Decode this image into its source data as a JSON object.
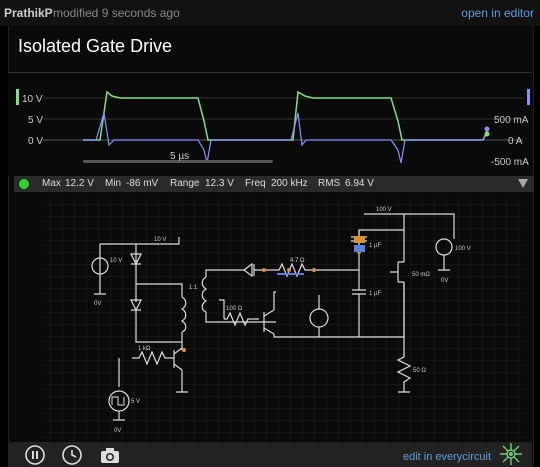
{
  "header": {
    "author": "PrathikP",
    "modified": "modified 9 seconds ago",
    "open_link": "open in editor"
  },
  "title": "Isolated Gate Drive",
  "scope": {
    "left_ticks": [
      "10 V",
      "5 V",
      "0 V"
    ],
    "right_ticks": [
      "500 mA",
      "0 A",
      "-500 mA"
    ],
    "time_label": "5 µs",
    "colors": {
      "voltage": "#7fe07f",
      "current": "#8d8dff",
      "bg": "#0a0a0a"
    }
  },
  "status": {
    "max_label": "Max",
    "max": "12.2 V",
    "min_label": "Min",
    "min": "-86 mV",
    "range_label": "Range",
    "range": "12.3 V",
    "freq_label": "Freq",
    "freq": "200 kHz",
    "rms_label": "RMS",
    "rms": "6.94 V"
  },
  "circuit": {
    "labels": {
      "v10_top": "10 V",
      "src_10v": "10 V",
      "ov_left": "0V",
      "ratio": "1:1",
      "r100": "100 Ω",
      "r1k": "1 kΩ",
      "pulse_label": "5 V",
      "pulse_0v": "0V",
      "r47": "4.7 Ω",
      "c_top": "1 µF",
      "c_small": "1 µF",
      "v100_top": "100 V",
      "src_100v": "100 V",
      "ov_right": "0V",
      "r50": "50 Ω",
      "mosfet": "50 mΩ"
    }
  },
  "footer": {
    "edit_link": "edit in everycircuit"
  }
}
